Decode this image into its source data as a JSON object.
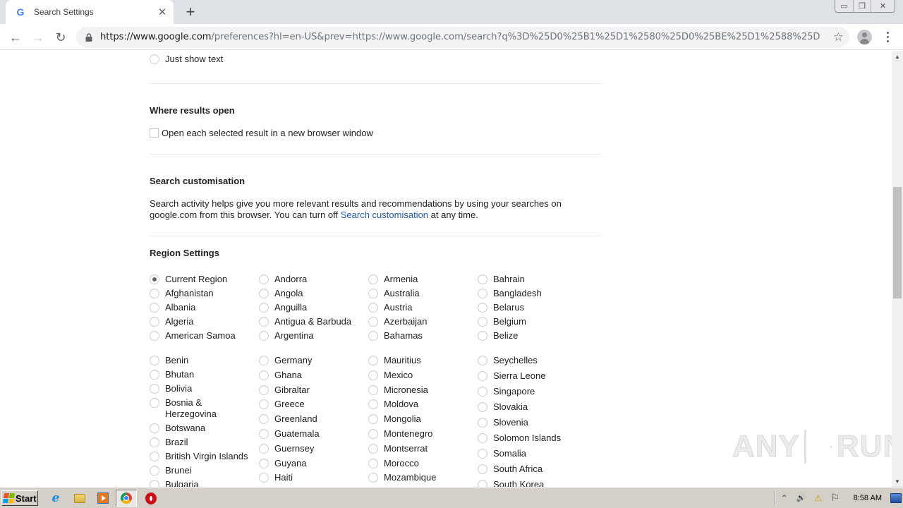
{
  "browser": {
    "tab": {
      "title": "Search Settings",
      "favicon": "google-g-icon",
      "favicon_glyph": "G",
      "close_glyph": "✕"
    },
    "new_tab_glyph": "+",
    "window_controls": {
      "minimize": "▭",
      "restore": "❐",
      "close": "✕"
    },
    "nav": {
      "back": "←",
      "forward": "→",
      "reload": "↻"
    },
    "url": {
      "host": "https://www.google.com",
      "rest": "/preferences?hl=en-US&prev=https://www.google.com/search?q%3D%25D0%25B1%25D1%2580%25D0%25BE%25D1%2588%25D1..."
    },
    "star_glyph": "☆"
  },
  "page": {
    "image_option": {
      "label": "Just show text",
      "checked": false
    },
    "where_results_open": {
      "title": "Where results open",
      "checkbox_label": "Open each selected result in a new browser window",
      "checked": false
    },
    "search_customisation": {
      "title": "Search customisation",
      "text_before": "Search activity helps give you more relevant results and recommendations by using your searches on google.com from this browser. You can turn off ",
      "link": "Search customisation",
      "text_after": " at any time."
    },
    "region_settings": {
      "title": "Region Settings",
      "selected": "Current Region",
      "group1": [
        [
          "Current Region",
          "Afghanistan",
          "Albania",
          "Algeria",
          "American Samoa"
        ],
        [
          "Andorra",
          "Angola",
          "Anguilla",
          "Antigua & Barbuda",
          "Argentina"
        ],
        [
          "Armenia",
          "Australia",
          "Austria",
          "Azerbaijan",
          "Bahamas"
        ],
        [
          "Bahrain",
          "Bangladesh",
          "Belarus",
          "Belgium",
          "Belize"
        ]
      ],
      "group2": [
        [
          "Benin",
          "Bhutan",
          "Bolivia",
          "Bosnia & Herzegovina",
          "Botswana",
          "Brazil",
          "British Virgin Islands",
          "Brunei",
          "Bulgaria"
        ],
        [
          "Germany",
          "Ghana",
          "Gibraltar",
          "Greece",
          "Greenland",
          "Guatemala",
          "Guernsey",
          "Guyana",
          "Haiti"
        ],
        [
          "Mauritius",
          "Mexico",
          "Micronesia",
          "Moldova",
          "Mongolia",
          "Montenegro",
          "Montserrat",
          "Morocco",
          "Mozambique"
        ],
        [
          "Seychelles",
          "Sierra Leone",
          "Singapore",
          "Slovakia",
          "Slovenia",
          "Solomon Islands",
          "Somalia",
          "South Africa",
          "South Korea"
        ]
      ]
    },
    "scrollbar": {
      "position_fraction": 0.33
    },
    "watermark": {
      "left": "ANY",
      "right": "RUN"
    }
  },
  "taskbar": {
    "start_label": "Start",
    "apps": [
      "internet-explorer",
      "windows-explorer",
      "media-player",
      "google-chrome",
      "opera"
    ],
    "ie_glyph": "e",
    "tray": {
      "show_hidden": "⌃",
      "volume": "🔊",
      "network": "⚠",
      "flag": "⚐"
    },
    "clock": "8:58 AM"
  }
}
